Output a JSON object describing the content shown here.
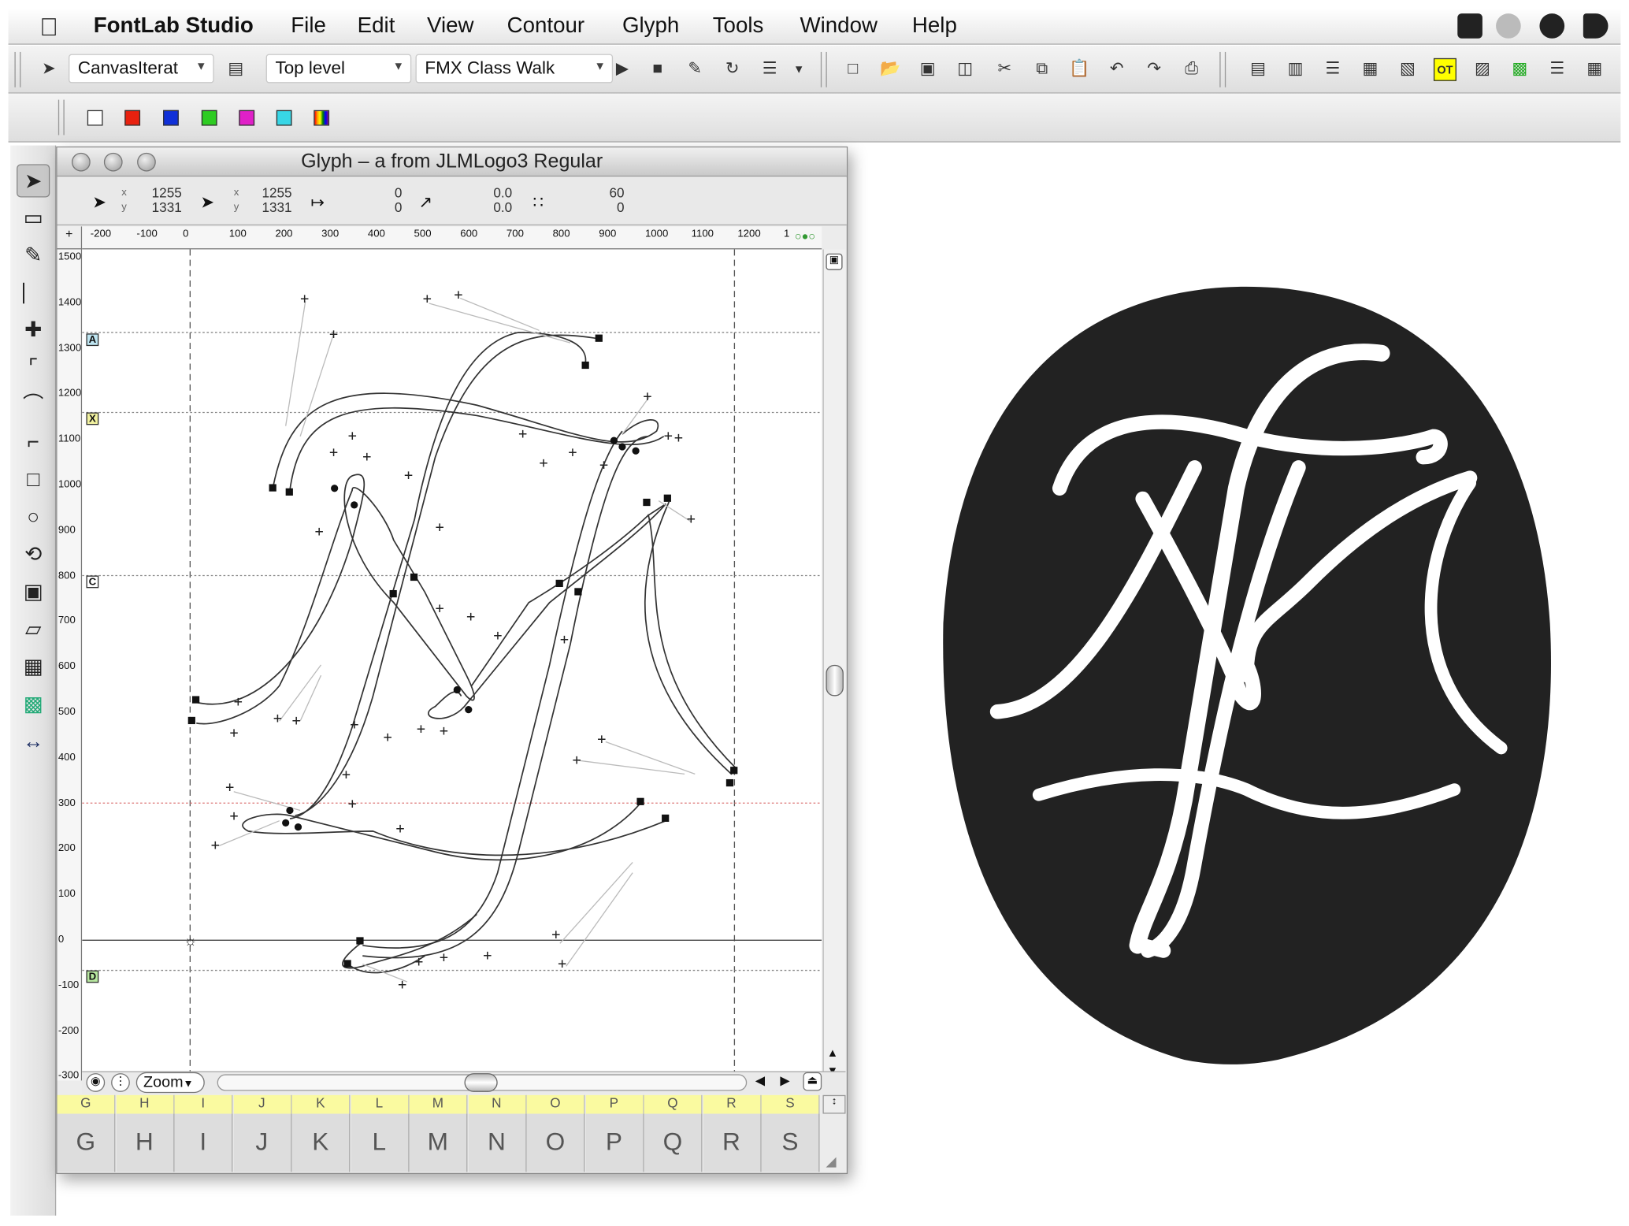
{
  "menubar": {
    "app_name": "FontLab Studio",
    "items": [
      "File",
      "Edit",
      "View",
      "Contour",
      "Glyph",
      "Tools",
      "Window",
      "Help"
    ]
  },
  "toolbar": {
    "canvas_mode": "CanvasIterat",
    "level": "Top level",
    "class_walk": "FMX Class Walk"
  },
  "color_swatches": [
    "#ffffff",
    "#e8210f",
    "#1030d8",
    "#2ecc22",
    "#e020c8",
    "#38d6e6",
    "#d8a020"
  ],
  "glyph_window": {
    "title": "Glyph – a from JLMLogo3 Regular",
    "coords": {
      "pointer_x": "1255",
      "pointer_y": "1331",
      "node_x": "1255",
      "node_y": "1331",
      "distance_a": "0",
      "distance_b": "0",
      "angle_a": "0.0",
      "angle_b": "0.0",
      "value_a": "60",
      "value_b": "0"
    },
    "h_ruler_labels": [
      "-200",
      "-100",
      "0",
      "100",
      "200",
      "300",
      "400",
      "500",
      "600",
      "700",
      "800",
      "900",
      "1000",
      "1100",
      "1200",
      "1"
    ],
    "v_ruler_labels": [
      "1500",
      "1400",
      "1300",
      "1200",
      "1100",
      "1000",
      "900",
      "800",
      "700",
      "600",
      "500",
      "400",
      "300",
      "200",
      "100",
      "0",
      "-100",
      "-200",
      "-300"
    ],
    "guide_labels": [
      "A",
      "X",
      "C",
      "D"
    ],
    "zoom_label": "Zoom",
    "glyph_headers": [
      "G",
      "H",
      "I",
      "J",
      "K",
      "L",
      "M",
      "N",
      "O",
      "P",
      "Q",
      "R",
      "S"
    ],
    "glyph_cells": [
      "G",
      "H",
      "I",
      "J",
      "K",
      "L",
      "M",
      "N",
      "O",
      "P",
      "Q",
      "R",
      "S"
    ]
  },
  "preview": {
    "description_color_bg": "#222222",
    "description_color_fg": "#ffffff"
  }
}
